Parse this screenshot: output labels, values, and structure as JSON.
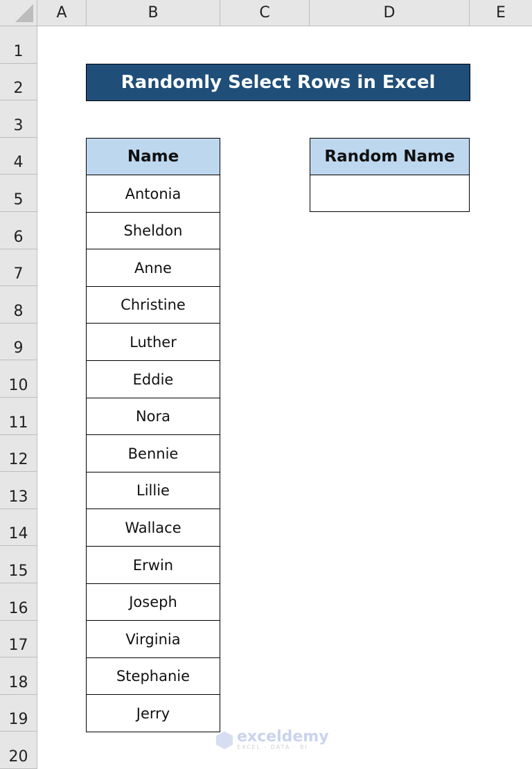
{
  "sheet": {
    "columns": [
      "A",
      "B",
      "C",
      "D",
      "E"
    ],
    "rows": [
      "1",
      "2",
      "3",
      "4",
      "5",
      "6",
      "7",
      "8",
      "9",
      "10",
      "11",
      "12",
      "13",
      "14",
      "15",
      "16",
      "17",
      "18",
      "19",
      "20"
    ]
  },
  "title": "Randomly Select Rows in Excel",
  "name_table": {
    "header": "Name",
    "values": [
      "Antonia",
      "Sheldon",
      "Anne",
      "Christine",
      "Luther",
      "Eddie",
      "Nora",
      "Bennie",
      "Lillie",
      "Wallace",
      "Erwin",
      "Joseph",
      "Virginia",
      "Stephanie",
      "Jerry"
    ]
  },
  "random_table": {
    "header": "Random Name",
    "value": ""
  },
  "watermark": {
    "brand": "exceldemy",
    "tagline": "EXCEL · DATA · BI"
  },
  "colors": {
    "title_bg": "#1f4e79",
    "header_bg": "#bdd7ee"
  }
}
